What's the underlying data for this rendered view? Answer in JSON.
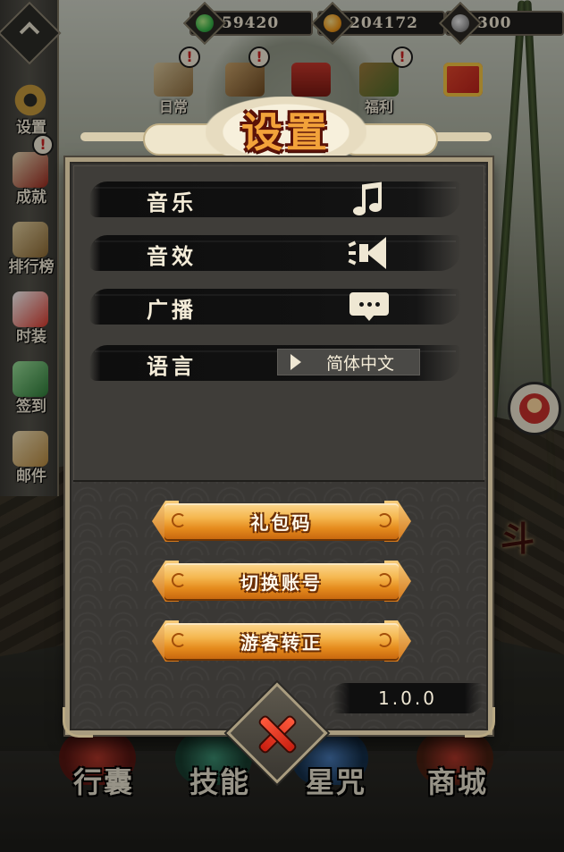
{
  "currency": [
    {
      "name": "jade",
      "value": "59420",
      "color": "#39b54a"
    },
    {
      "name": "gold-coin",
      "value": "204172",
      "color": "#f29b1d"
    },
    {
      "name": "silver-token",
      "value": "300",
      "color": "#9c9c9c"
    }
  ],
  "sidebar": {
    "items": [
      {
        "label": "设置",
        "icon": "gear-icon"
      },
      {
        "label": "成就",
        "icon": "achievement-icon"
      },
      {
        "label": "排行榜",
        "icon": "scroll-icon"
      },
      {
        "label": "时装",
        "icon": "fox-mask-icon"
      },
      {
        "label": "签到",
        "icon": "jade-icon"
      },
      {
        "label": "邮件",
        "icon": "envelope-icon"
      }
    ]
  },
  "top_icons": [
    {
      "label": "日常",
      "icon": "daily-scroll-icon"
    },
    {
      "label": "",
      "icon": "notice-board-icon"
    },
    {
      "label": "",
      "icon": "torii-gate-icon"
    },
    {
      "label": "福利",
      "icon": "treasure-icon"
    },
    {
      "label": "",
      "icon": "gift-box-icon"
    }
  ],
  "badge_text": "!",
  "dialog": {
    "title": "设置",
    "rows": [
      {
        "label": "音乐",
        "control": "music-note-icon"
      },
      {
        "label": "音效",
        "control": "speaker-icon"
      },
      {
        "label": "广播",
        "control": "chat-bubble-icon"
      },
      {
        "label": "语言",
        "control": "language-select",
        "value": "简体中文"
      }
    ],
    "buttons": [
      {
        "label": "礼包码"
      },
      {
        "label": "切换账号"
      },
      {
        "label": "游客转正"
      }
    ],
    "version": "1.0.0"
  },
  "bottom_nav": [
    {
      "label": "行囊"
    },
    {
      "label": "技能"
    },
    {
      "label": "星咒"
    },
    {
      "label": "商城"
    }
  ],
  "side_glyph": "斗",
  "colors": {
    "panel_border": "#a99c7f",
    "button_gold": "#f5b74f",
    "title_orange": "#f2a23a",
    "close_red": "#e0301c"
  }
}
